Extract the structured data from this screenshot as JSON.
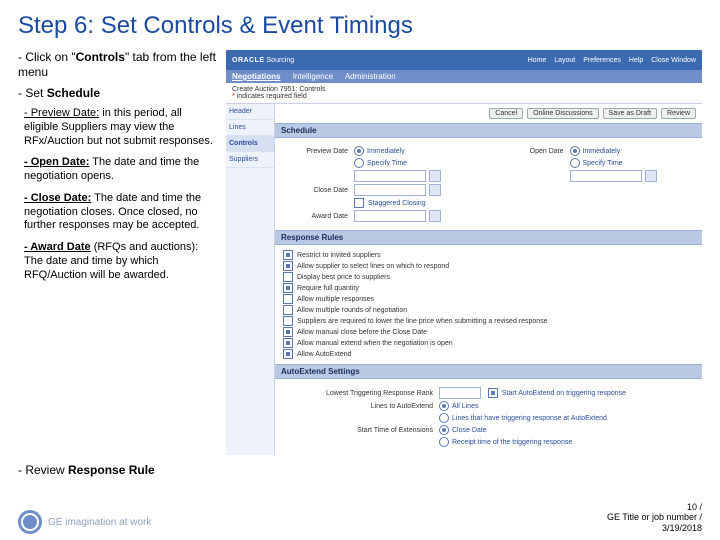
{
  "title": "Step 6: Set Controls & Event Timings",
  "left": {
    "clickControls_pre": "- Click on \"",
    "clickControls_em": "Controls",
    "clickControls_post": "\" tab from the left menu",
    "setSchedule_pre": "- Set ",
    "setSchedule_em": "Schedule",
    "preview_label": "- Preview Date:",
    "preview_txt": " in this period, all eligible Suppliers may view the RFx/Auction but not submit responses.",
    "open_label": "- Open Date:",
    "open_txt": " The date and time the negotiation opens.",
    "close_label": "- Close Date:",
    "close_txt": " The date and time the negotiation closes. Once closed, no further responses may be accepted.",
    "award_label": "- Award Date",
    "award_txt": " (RFQs and auctions): The date and time by which RFQ/Auction will be awarded.",
    "review_pre": "- Review ",
    "review_em": "Response Rule"
  },
  "app": {
    "brand": "ORACLE",
    "brandSuffix": " Sourcing",
    "topLinks": [
      "Home",
      "Layout",
      "Preferences",
      "Help",
      "Close Window"
    ],
    "tabs": [
      "Negotiations",
      "Intelligence",
      "Administration"
    ],
    "crumbPrefix": "* ",
    "crumb": "indicates required field",
    "crumbTitle": "Create Auction 7951: Controls",
    "side": [
      "Header",
      "Lines",
      "Controls",
      "Suppliers"
    ],
    "buttons": [
      "Cancel",
      "Online Discussions",
      "Save as Draft",
      "Review"
    ],
    "schedule": {
      "title": "Schedule",
      "previewLbl": "Preview Date",
      "immediately": "Immediately",
      "specifyTime": "Specify Time",
      "openLbl": "Open Date",
      "closeLbl": "Close Date",
      "staggered": "Staggered Closing",
      "awardLbl": "Award Date"
    },
    "rules": {
      "title": "Response Rules",
      "items": [
        "Restrict to invited suppliers",
        "Allow supplier to select lines on which to respond",
        "Display best price to suppliers",
        "Require full quantity",
        "Allow multiple responses",
        "Allow multiple rounds of negotiation",
        "Suppliers are required to lower the line price when submitting a revised response",
        "Allow manual close before the Close Date",
        "Allow manual extend when the negotiation is open",
        "Allow AutoExtend"
      ]
    },
    "autoext": {
      "title": "AutoExtend Settings",
      "trigLbl": "Lowest Triggering Response Rank",
      "trigOpt": "Start AutoExtend on triggering response",
      "toExtendLbl": "Lines to AutoExtend",
      "toExt1": "All Lines",
      "toExt2": "Lines that have triggering response at AutoExtend",
      "startLbl": "Start Time of Extensions",
      "start1": "Close Date",
      "start2": "Receipt time of the triggering response"
    }
  },
  "footer": {
    "tagline": "GE imagination at work",
    "page": "10 /",
    "line2": "GE Title or job number /",
    "date": "3/19/2018"
  }
}
